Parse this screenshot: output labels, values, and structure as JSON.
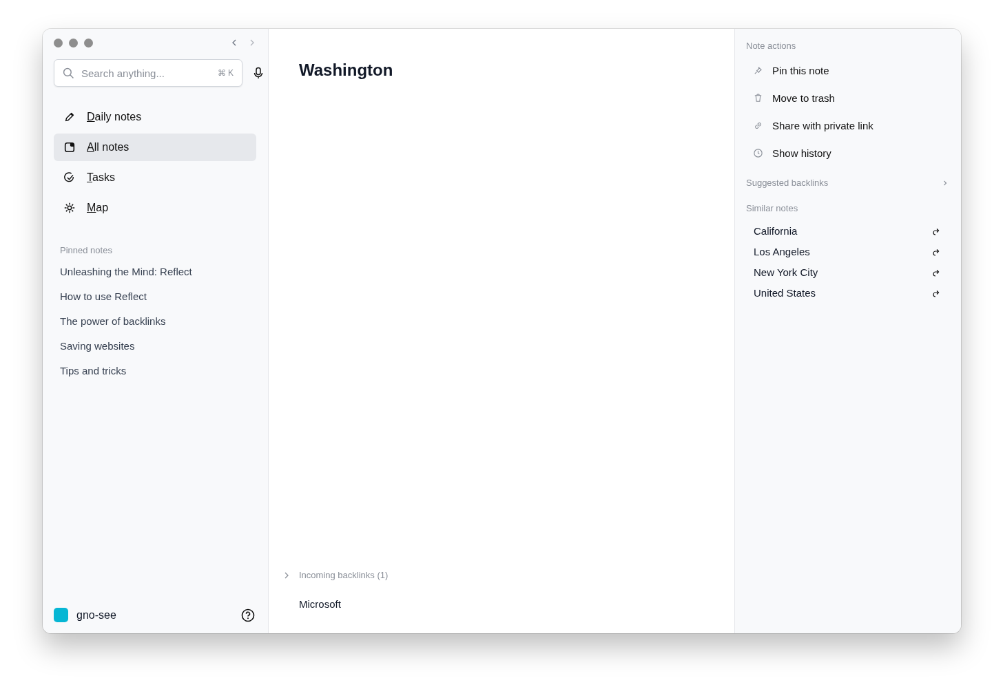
{
  "sidebar": {
    "search": {
      "placeholder": "Search anything...",
      "shortcut": "⌘ K"
    },
    "nav": [
      {
        "kind": "pencil",
        "label": "Daily notes",
        "selected": false
      },
      {
        "kind": "note",
        "label": "All notes",
        "selected": true
      },
      {
        "kind": "check",
        "label": "Tasks",
        "selected": false
      },
      {
        "kind": "map",
        "label": "Map",
        "selected": false
      }
    ],
    "pinned_title": "Pinned notes",
    "pinned": [
      "Unleashing the Mind: Reflect",
      "How to use Reflect",
      "The power of backlinks",
      "Saving websites",
      "Tips and tricks"
    ],
    "workspace": "gno-see"
  },
  "note": {
    "title": "Washington",
    "backlinks_label": "Incoming backlinks (1)",
    "backlinks": [
      "Microsoft"
    ]
  },
  "panel": {
    "actions_title": "Note actions",
    "actions": [
      {
        "kind": "pin",
        "label": "Pin this note"
      },
      {
        "kind": "trash",
        "label": "Move to trash"
      },
      {
        "kind": "link",
        "label": "Share with private link"
      },
      {
        "kind": "clock",
        "label": "Show history"
      }
    ],
    "suggested_title": "Suggested backlinks",
    "similar_title": "Similar notes",
    "similar": [
      "California",
      "Los Angeles",
      "New York City",
      "United States"
    ]
  }
}
